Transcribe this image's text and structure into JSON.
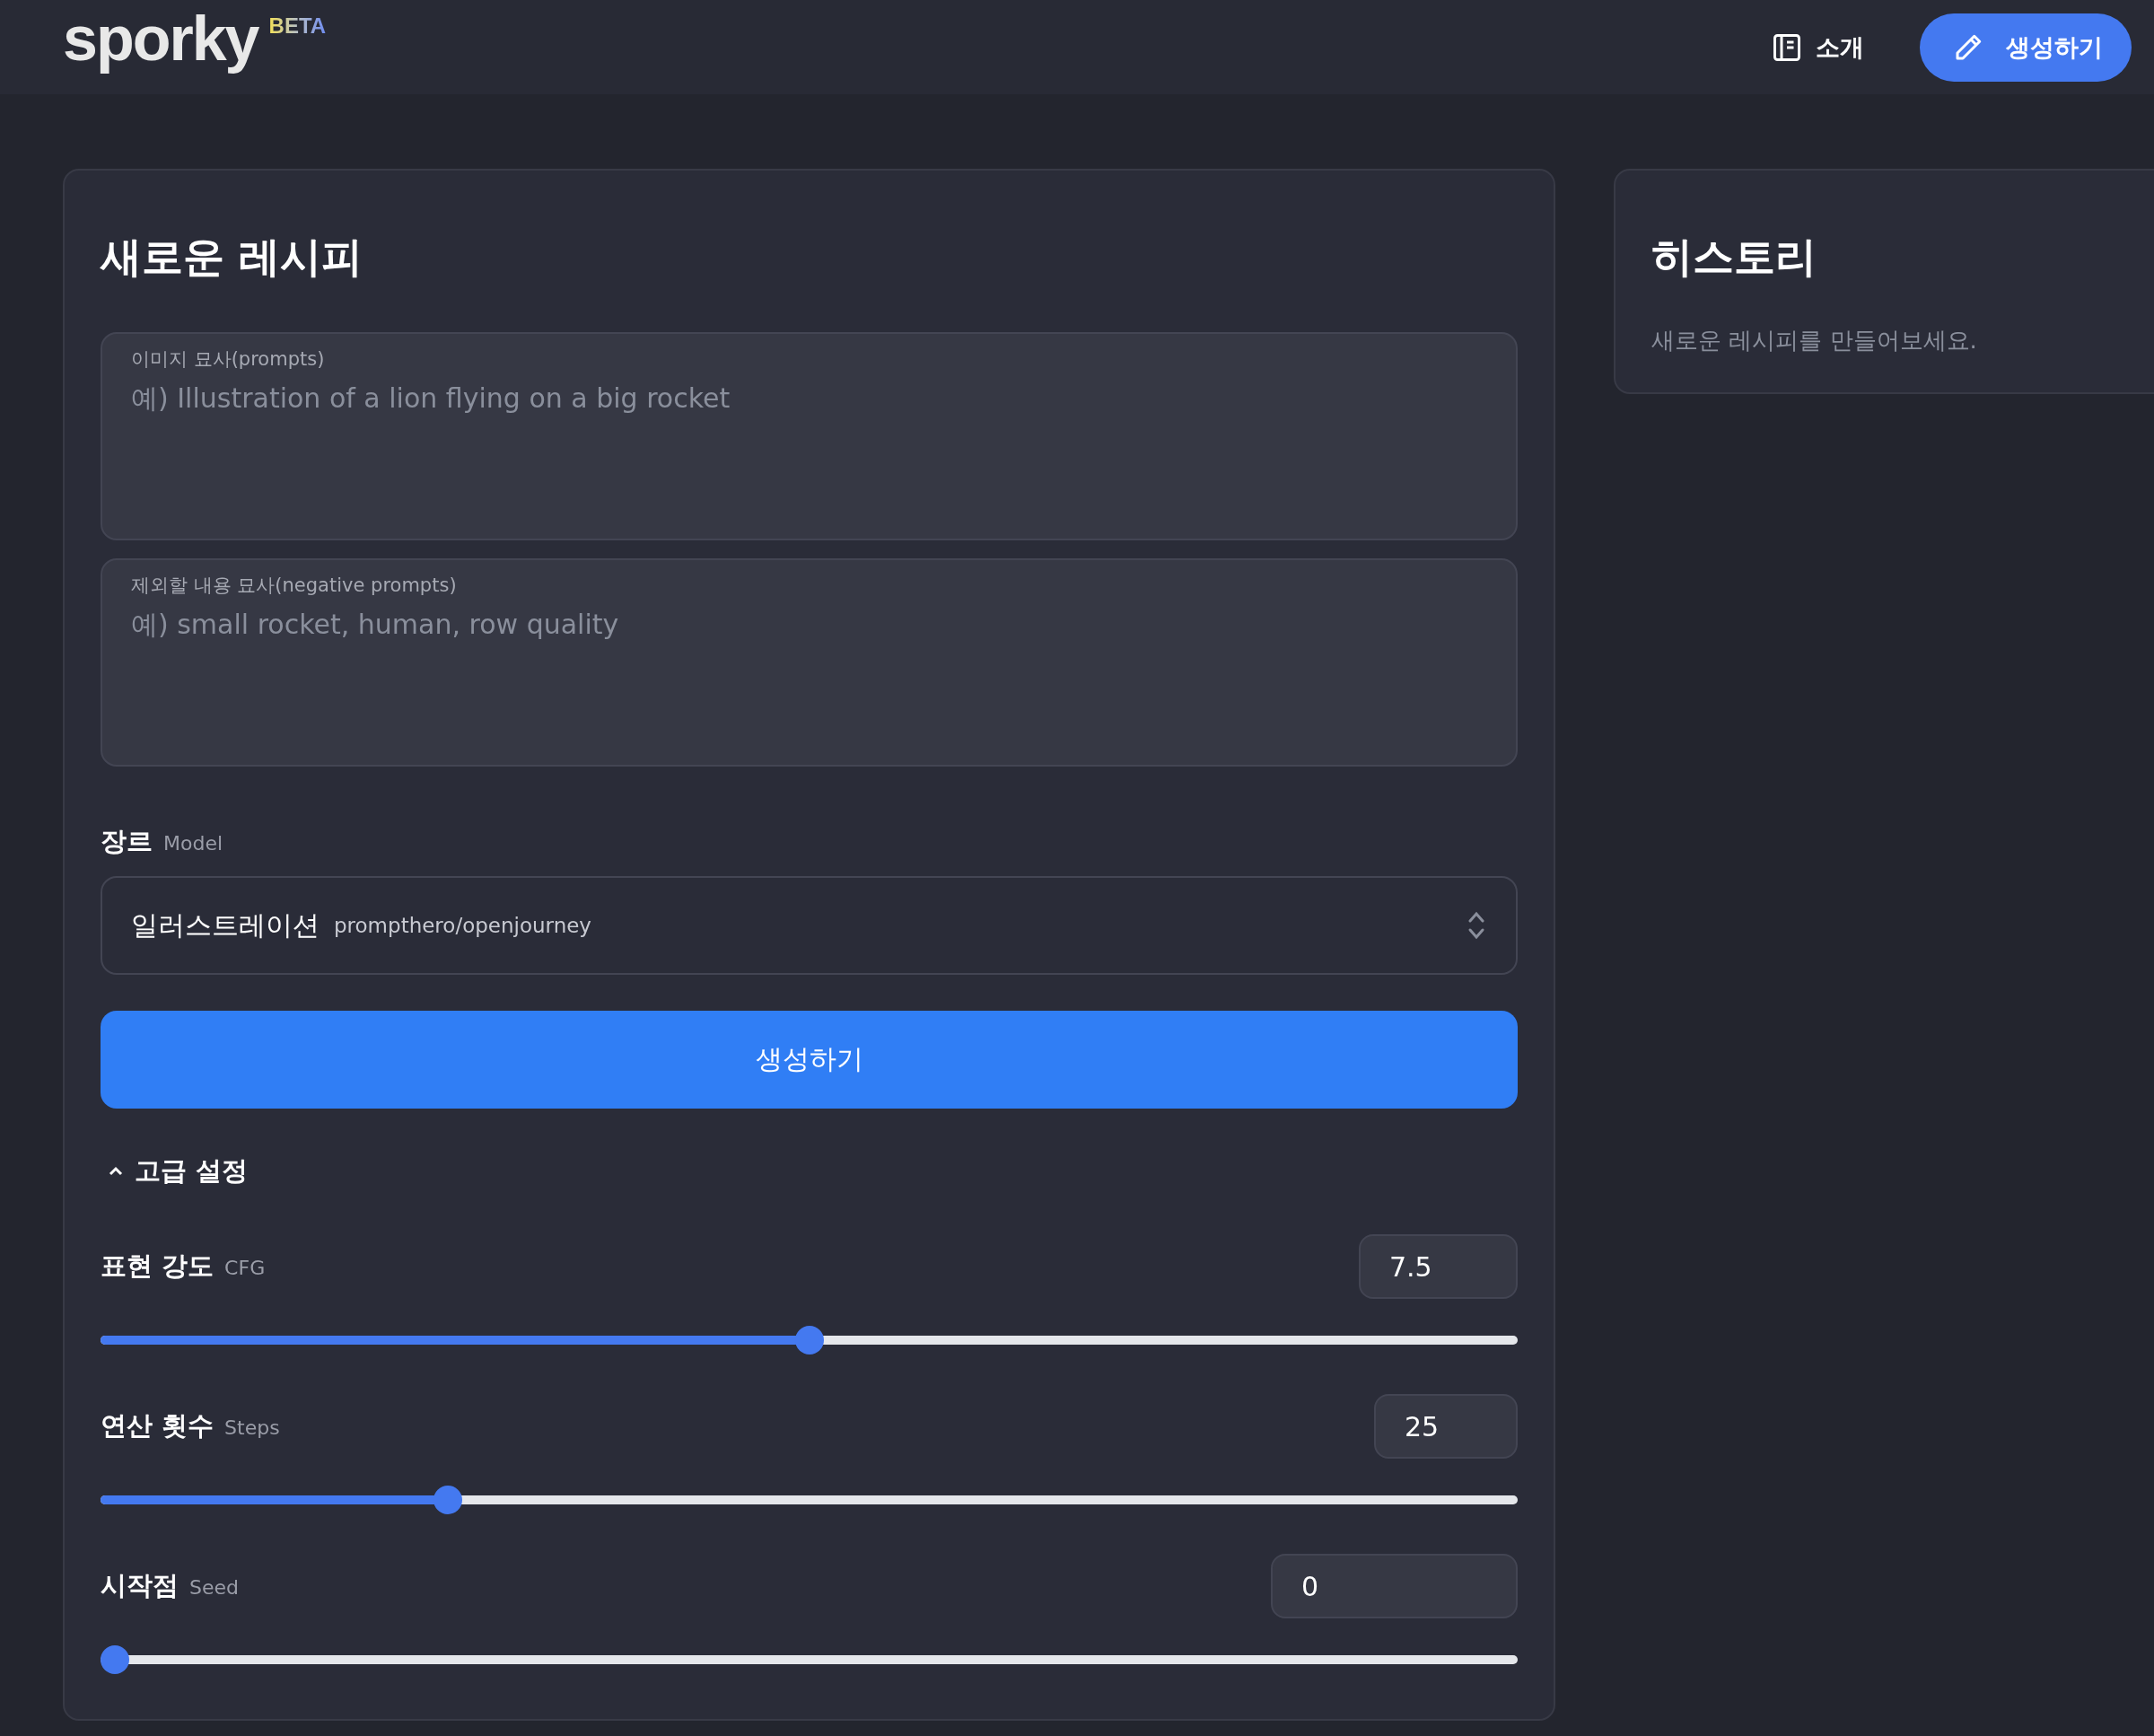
{
  "header": {
    "logo": "sporky",
    "badge": "BETA",
    "nav": [
      {
        "kind": "link",
        "label": "소개"
      },
      {
        "kind": "primary",
        "label": "생성하기"
      }
    ]
  },
  "recipe": {
    "title": "새로운 레시피",
    "prompts": [
      {
        "label": "이미지 묘사(prompts)",
        "placeholder": "예) Illustration of a lion flying on a big rocket"
      },
      {
        "label": "제외할 내용 묘사(negative prompts)",
        "placeholder": "예) small rocket, human, row quality"
      }
    ],
    "model": {
      "label": "장르",
      "sublabel": "Model",
      "value": "일러스트레이션",
      "detail": "prompthero/openjourney"
    },
    "submit": "생성하기",
    "advanced": {
      "label": "고급 설정",
      "expanded": true,
      "settings": [
        {
          "label": "표현 강도",
          "sublabel": "CFG",
          "value": "7.5",
          "level": 0.5
        },
        {
          "label": "연산 횟수",
          "sublabel": "Steps",
          "value": "25",
          "level": 0.24
        },
        {
          "label": "시작점",
          "sublabel": "Seed",
          "value": "0",
          "level": 0
        }
      ]
    }
  },
  "history": {
    "title": "히스토리",
    "empty": "새로운 레시피를 만들어보세요."
  }
}
